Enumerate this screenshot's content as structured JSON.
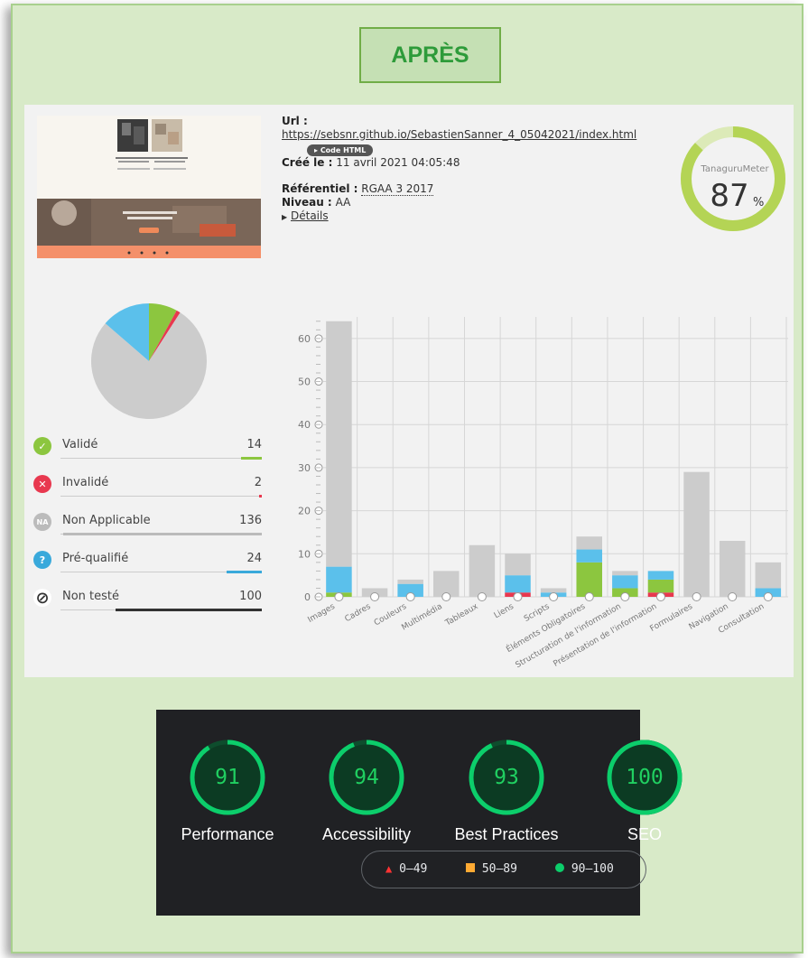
{
  "header": {
    "title": "APRÈS"
  },
  "audit": {
    "url_label": "Url :",
    "url": "https://sebsnr.github.io/SebastienSanner_4_05042021/index.html",
    "code_button": "Code HTML",
    "created_label": "Créé le :",
    "created_value": "11 avril 2021 04:05:48",
    "ref_label": "Référentiel :",
    "ref_value": "RGAA 3 2017",
    "level_label": "Niveau :",
    "level_value": "AA",
    "details_link": "Détails"
  },
  "meter": {
    "label": "TanaguruMeter",
    "value": "87",
    "unit": "%",
    "fraction": 0.87,
    "color": "#b4d455"
  },
  "summary": [
    {
      "label": "Validé",
      "value": "14",
      "color": "#8cc63f",
      "icon": "check-icon",
      "glyph": "✓"
    },
    {
      "label": "Invalidé",
      "value": "2",
      "color": "#e8384f",
      "icon": "cross-icon",
      "glyph": "✕"
    },
    {
      "label": "Non Applicable",
      "value": "136",
      "color": "#bbbbbb",
      "icon": "na-icon",
      "glyph": "NA"
    },
    {
      "label": "Pré-qualifié",
      "value": "24",
      "color": "#39a9db",
      "icon": "question-icon",
      "glyph": "?"
    },
    {
      "label": "Non testé",
      "value": "100",
      "color": "#333333",
      "icon": "not-tested-icon",
      "glyph": "⊘"
    }
  ],
  "chart_data": [
    {
      "type": "pie",
      "labels": [
        "Validé",
        "Invalidé",
        "Non Applicable",
        "Pré-qualifié"
      ],
      "values": [
        14,
        2,
        136,
        24
      ],
      "colors": [
        "#8cc63f",
        "#e8384f",
        "#cccccc",
        "#5bc0eb"
      ]
    },
    {
      "type": "bar",
      "stacked": true,
      "categories": [
        "Images",
        "Cadres",
        "Couleurs",
        "Multimédia",
        "Tableaux",
        "Liens",
        "Scripts",
        "Éléments Obligatoires",
        "Structuration de l'information",
        "Présentation de l'information",
        "Formulaires",
        "Navigation",
        "Consultation"
      ],
      "series": [
        {
          "name": "Invalidé",
          "color": "#e8384f",
          "values": [
            0,
            0,
            0,
            0,
            0,
            1,
            0,
            0,
            0,
            1,
            0,
            0,
            0
          ]
        },
        {
          "name": "Validé",
          "color": "#8cc63f",
          "values": [
            1,
            0,
            0,
            0,
            0,
            0,
            0,
            8,
            2,
            3,
            0,
            0,
            0
          ]
        },
        {
          "name": "Pré-qualifié",
          "color": "#5bc0eb",
          "values": [
            6,
            0,
            3,
            0,
            0,
            4,
            1,
            3,
            3,
            2,
            0,
            0,
            2
          ]
        },
        {
          "name": "Non Applicable",
          "color": "#cccccc",
          "values": [
            57,
            2,
            1,
            6,
            12,
            5,
            1,
            3,
            1,
            0,
            29,
            13,
            6
          ]
        }
      ],
      "yticks": [
        0,
        10,
        20,
        30,
        40,
        50,
        60
      ],
      "ylim": [
        0,
        65
      ],
      "grid": true
    }
  ],
  "lighthouse": {
    "scores": [
      {
        "label": "Performance",
        "value": "91",
        "score": 0.91
      },
      {
        "label": "Accessibility",
        "value": "94",
        "score": 0.94
      },
      {
        "label": "Best Practices",
        "value": "93",
        "score": 0.93
      },
      {
        "label": "SEO",
        "value": "100",
        "score": 1.0
      }
    ],
    "legend": [
      {
        "range": "0–49",
        "color": "#ff3333",
        "shape": "triangle"
      },
      {
        "range": "50–89",
        "color": "#ffaa33",
        "shape": "square"
      },
      {
        "range": "90–100",
        "color": "#0cce6b",
        "shape": "circle"
      }
    ],
    "gauge_color": "#0cce6b"
  }
}
